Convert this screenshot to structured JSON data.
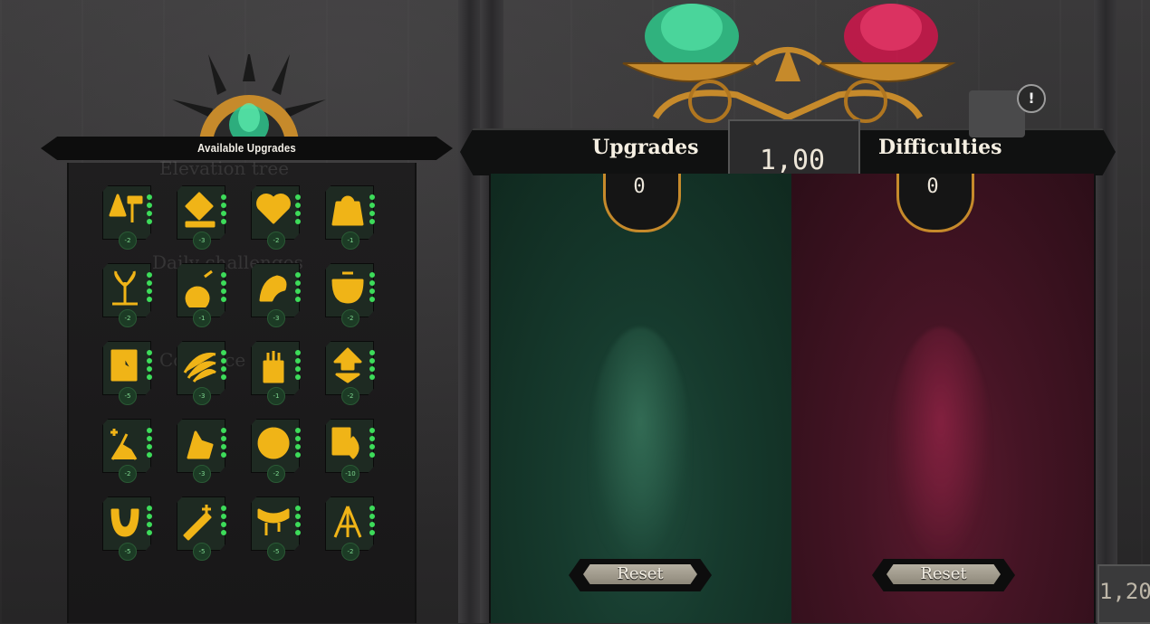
{
  "left_panel": {
    "title": "Available Upgrades",
    "ghost_labels": [
      "Elevation tree",
      "Daily challenges",
      "Co…ance"
    ],
    "upgrades": [
      {
        "icon": "spade-sword-icon",
        "cost": "-2"
      },
      {
        "icon": "diamond-hand-icon",
        "cost": "-3"
      },
      {
        "icon": "heart-hand-icon",
        "cost": "-2"
      },
      {
        "icon": "bag-hand-icon",
        "cost": "-1"
      },
      {
        "icon": "sprout-icon",
        "cost": "-2"
      },
      {
        "icon": "bomb-hand-icon",
        "cost": "-1"
      },
      {
        "icon": "strong-arm-icon",
        "cost": "-3"
      },
      {
        "icon": "cauldron-icon",
        "cost": "-2"
      },
      {
        "icon": "clock-scroll-icon",
        "cost": "-5"
      },
      {
        "icon": "claw-slash-icon",
        "cost": "-3"
      },
      {
        "icon": "fist-up-icon",
        "cost": "-1"
      },
      {
        "icon": "heart-arrow-icon",
        "cost": "-2"
      },
      {
        "icon": "runner-plus-icon",
        "cost": "-2"
      },
      {
        "icon": "hand-pointer-icon",
        "cost": "-3"
      },
      {
        "icon": "circle-plus-icon",
        "cost": "-2"
      },
      {
        "icon": "fire-card-icon",
        "cost": "-10"
      },
      {
        "icon": "horseshoe-icon",
        "cost": "-5"
      },
      {
        "icon": "blade-plus-icon",
        "cost": "-5"
      },
      {
        "icon": "drip-icon",
        "cost": "-5"
      },
      {
        "icon": "tripod-icon",
        "cost": "-2"
      }
    ]
  },
  "balance": {
    "center_value": "1,00",
    "upgrades": {
      "label": "Upgrades",
      "count": "0",
      "reset": "Reset"
    },
    "difficulties": {
      "label": "Difficulties",
      "count": "0",
      "reset": "Reset"
    }
  },
  "right_edge": {
    "value": "1,20",
    "alert": "!"
  },
  "colors": {
    "upgrade_green": "#3ddc5a",
    "difficulty_red": "#d0224d",
    "gold": "#c68a2b",
    "icon_yellow": "#f0b417"
  }
}
